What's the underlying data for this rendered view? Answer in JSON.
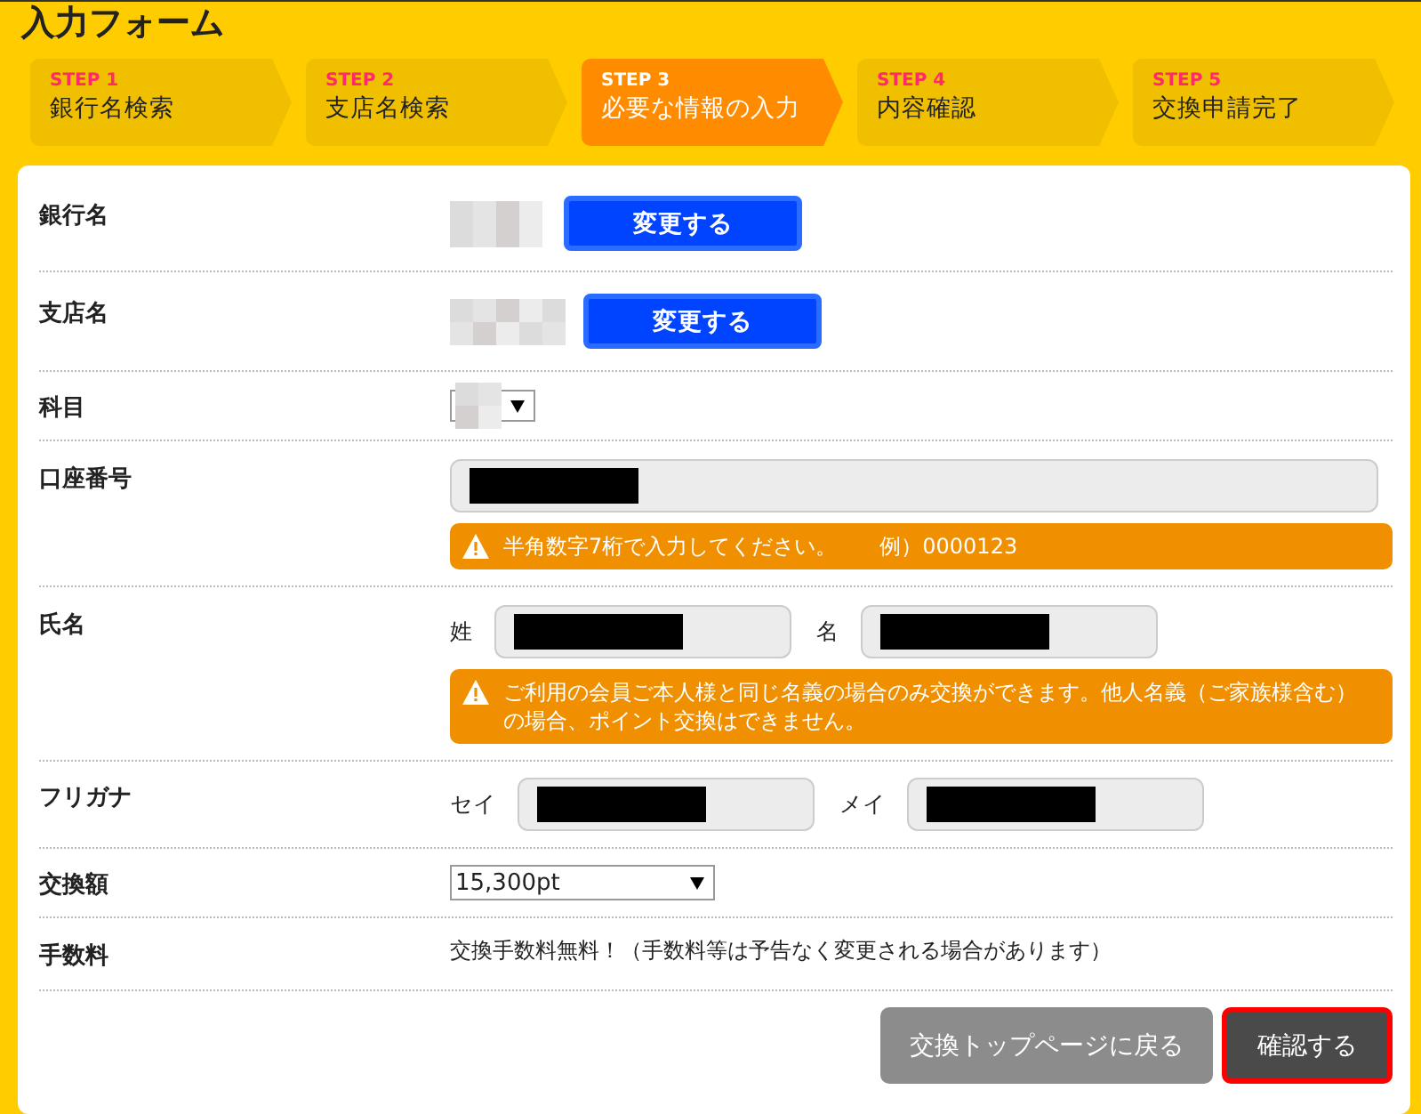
{
  "title": "入力フォーム",
  "steps": [
    {
      "step": "STEP 1",
      "label": "銀行名検索",
      "selected": false
    },
    {
      "step": "STEP 2",
      "label": "支店名検索",
      "selected": false
    },
    {
      "step": "STEP 3",
      "label": "必要な情報の入力",
      "selected": true
    },
    {
      "step": "STEP 4",
      "label": "内容確認",
      "selected": false
    },
    {
      "step": "STEP 5",
      "label": "交換申請完了",
      "selected": false
    }
  ],
  "rows": [
    {
      "label": "銀行名",
      "kind": "change",
      "button": "変更する"
    },
    {
      "label": "支店名",
      "kind": "change",
      "button": "変更する"
    },
    {
      "label": "科目",
      "kind": "select"
    },
    {
      "label": "口座番号",
      "kind": "input",
      "notice": [
        "半角数字7桁で入力してください。",
        "例）0000123"
      ]
    },
    {
      "label": "氏名",
      "kind": "pair",
      "fields": [
        "姓",
        "名"
      ],
      "notice": [
        "ご利用の会員ご本人様と同じ名義の場合のみ交換ができます。他人名義（ご家族様含む）の場合、ポイント交換はできません。"
      ]
    },
    {
      "label": "フリガナ",
      "kind": "pair",
      "fields": [
        "セイ",
        "メイ"
      ]
    },
    {
      "label": "交換額",
      "kind": "dropdown",
      "value": "15,300pt"
    },
    {
      "label": "手数料",
      "kind": "text",
      "text": "交換手数料無料！（手数料等は予告なく変更される場合があります）"
    }
  ],
  "buttons": [
    {
      "label": "交換トップページに戻る",
      "kind": "secondary"
    },
    {
      "label": "確認する",
      "kind": "primary"
    }
  ]
}
